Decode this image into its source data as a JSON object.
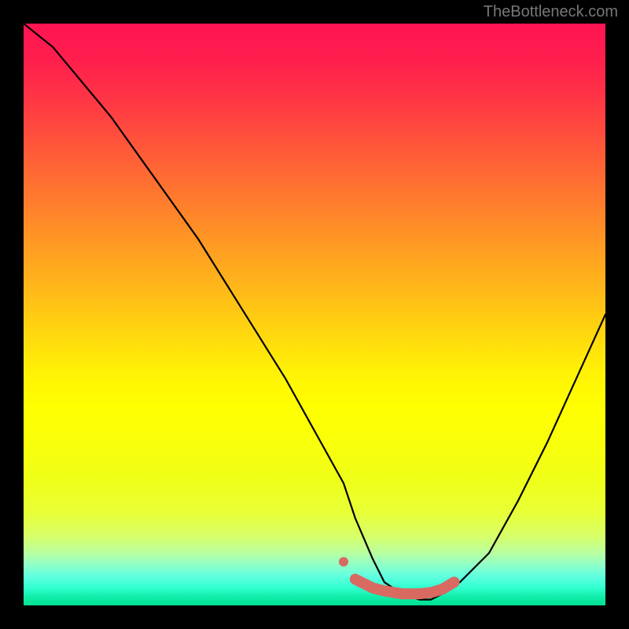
{
  "watermark": "TheBottleneck.com",
  "chart_data": {
    "type": "line",
    "title": "",
    "xlabel": "",
    "ylabel": "",
    "xlim": [
      0,
      100
    ],
    "ylim": [
      0,
      100
    ],
    "series": [
      {
        "name": "bottleneck-curve",
        "x": [
          0,
          5,
          10,
          15,
          20,
          25,
          30,
          35,
          40,
          45,
          50,
          55,
          57,
          60,
          62,
          65,
          68,
          70,
          72,
          75,
          80,
          85,
          90,
          95,
          100
        ],
        "values": [
          100,
          96,
          90,
          84,
          77,
          70,
          63,
          55,
          47,
          39,
          30,
          21,
          15,
          8,
          4,
          2,
          1,
          1,
          2,
          4,
          9,
          18,
          28,
          39,
          50
        ]
      },
      {
        "name": "optimal-marker",
        "x": [
          57,
          60,
          62,
          65,
          68,
          70,
          72,
          74
        ],
        "values": [
          4.5,
          3.0,
          2.5,
          2.0,
          2.0,
          2.2,
          2.8,
          4.0
        ]
      }
    ],
    "gradient_meaning": "vertical color gradient from red (high bottleneck) at top to green (optimal) at bottom",
    "annotations": []
  }
}
